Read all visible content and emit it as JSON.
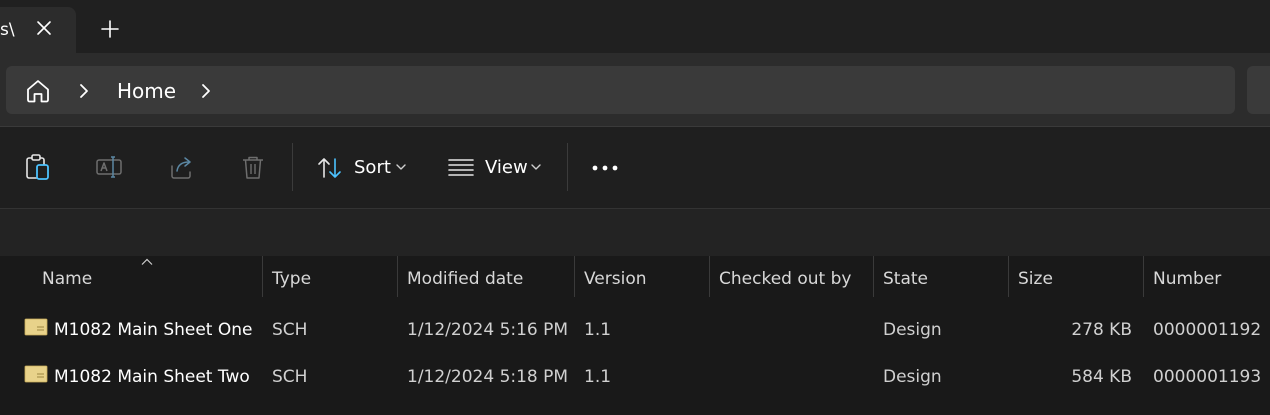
{
  "tab": {
    "title": "s\\",
    "close_label": "close tab",
    "new_label": "new tab"
  },
  "breadcrumb": {
    "items": [
      "Home"
    ]
  },
  "toolbar": {
    "sort_label": "Sort",
    "view_label": "View"
  },
  "columns": [
    "Name",
    "Type",
    "Modified date",
    "Version",
    "Checked out by",
    "State",
    "Size",
    "Number"
  ],
  "rows": [
    {
      "name": "M1082 Main Sheet One",
      "type": "SCH",
      "modified": "1/12/2024 5:16 PM",
      "version": "1.1",
      "checked_out_by": "",
      "state": "Design",
      "size": "278 KB",
      "number": "0000001192"
    },
    {
      "name": "M1082 Main Sheet Two",
      "type": "SCH",
      "modified": "1/12/2024 5:18 PM",
      "version": "1.1",
      "checked_out_by": "",
      "state": "Design",
      "size": "584 KB",
      "number": "0000001193"
    }
  ],
  "colors": {
    "accent": "#4cc2ff",
    "background": "#191919",
    "file_icon": "#e8d28a"
  }
}
